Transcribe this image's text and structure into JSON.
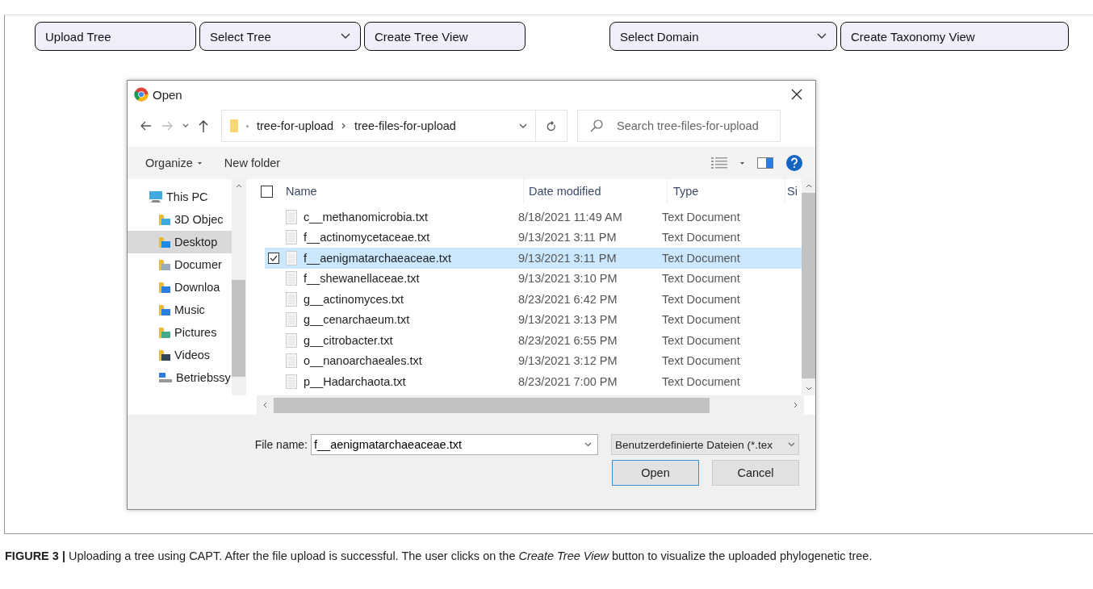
{
  "toolbar": [
    {
      "kind": "button",
      "label": "Upload Tree"
    },
    {
      "kind": "select",
      "label": "Select Tree"
    },
    {
      "kind": "button",
      "label": "Create Tree View"
    },
    {
      "kind": "spacer"
    },
    {
      "kind": "select",
      "label": "Select Domain"
    },
    {
      "kind": "button",
      "label": "Create Taxonomy View"
    }
  ],
  "dialog": {
    "title": "Open",
    "breadcrumb": [
      "tree-for-upload",
      "tree-files-for-upload"
    ],
    "search": {
      "placeholder": "Search tree-files-for-upload"
    },
    "commands": [
      "Organize",
      "New folder"
    ],
    "nav": [
      {
        "label": "This PC",
        "kind": "pc",
        "selected": false,
        "children": [
          {
            "label": "3D Objec",
            "kind": "objects",
            "selected": false
          },
          {
            "label": "Desktop",
            "kind": "desktop",
            "selected": true
          },
          {
            "label": "Documer",
            "kind": "documents",
            "selected": false
          },
          {
            "label": "Downloa",
            "kind": "downloads",
            "selected": false
          },
          {
            "label": "Music",
            "kind": "music",
            "selected": false
          },
          {
            "label": "Pictures",
            "kind": "pictures",
            "selected": false
          },
          {
            "label": "Videos",
            "kind": "videos",
            "selected": false
          },
          {
            "label": "Betriebssy",
            "kind": "drive",
            "selected": false
          }
        ]
      }
    ],
    "columns": [
      "Name",
      "Date modified",
      "Type",
      "Si"
    ],
    "files": [
      {
        "name": "c__methanomicrobia.txt",
        "date": "8/18/2021 11:49 AM",
        "type": "Text Document",
        "selected": false
      },
      {
        "name": "f__actinomycetaceae.txt",
        "date": "9/13/2021 3:11 PM",
        "type": "Text Document",
        "selected": false
      },
      {
        "name": "f__aenigmatarchaeaceae.txt",
        "date": "9/13/2021 3:11 PM",
        "type": "Text Document",
        "selected": true
      },
      {
        "name": "f__shewanellaceae.txt",
        "date": "9/13/2021 3:10 PM",
        "type": "Text Document",
        "selected": false
      },
      {
        "name": "g__actinomyces.txt",
        "date": "8/23/2021 6:42 PM",
        "type": "Text Document",
        "selected": false
      },
      {
        "name": "g__cenarchaeum.txt",
        "date": "9/13/2021 3:13 PM",
        "type": "Text Document",
        "selected": false
      },
      {
        "name": "g__citrobacter.txt",
        "date": "8/23/2021 6:55 PM",
        "type": "Text Document",
        "selected": false
      },
      {
        "name": "o__nanoarchaeales.txt",
        "date": "9/13/2021 3:12 PM",
        "type": "Text Document",
        "selected": false
      },
      {
        "name": "p__Hadarchaota.txt",
        "date": "8/23/2021 7:00 PM",
        "type": "Text Document",
        "selected": false
      }
    ],
    "file_name_label": "File name:",
    "file_name": "f__aenigmatarchaeaceae.txt",
    "file_type": "Benutzerdefinierte Dateien (*.tex",
    "buttons": [
      "Open",
      "Cancel"
    ]
  },
  "caption": "**FIGURE 3 |** Uploading a tree using CAPT. After the file upload is successful. The user clicks on the *Create Tree View* button to visualize the uploaded phylogenetic tree."
}
